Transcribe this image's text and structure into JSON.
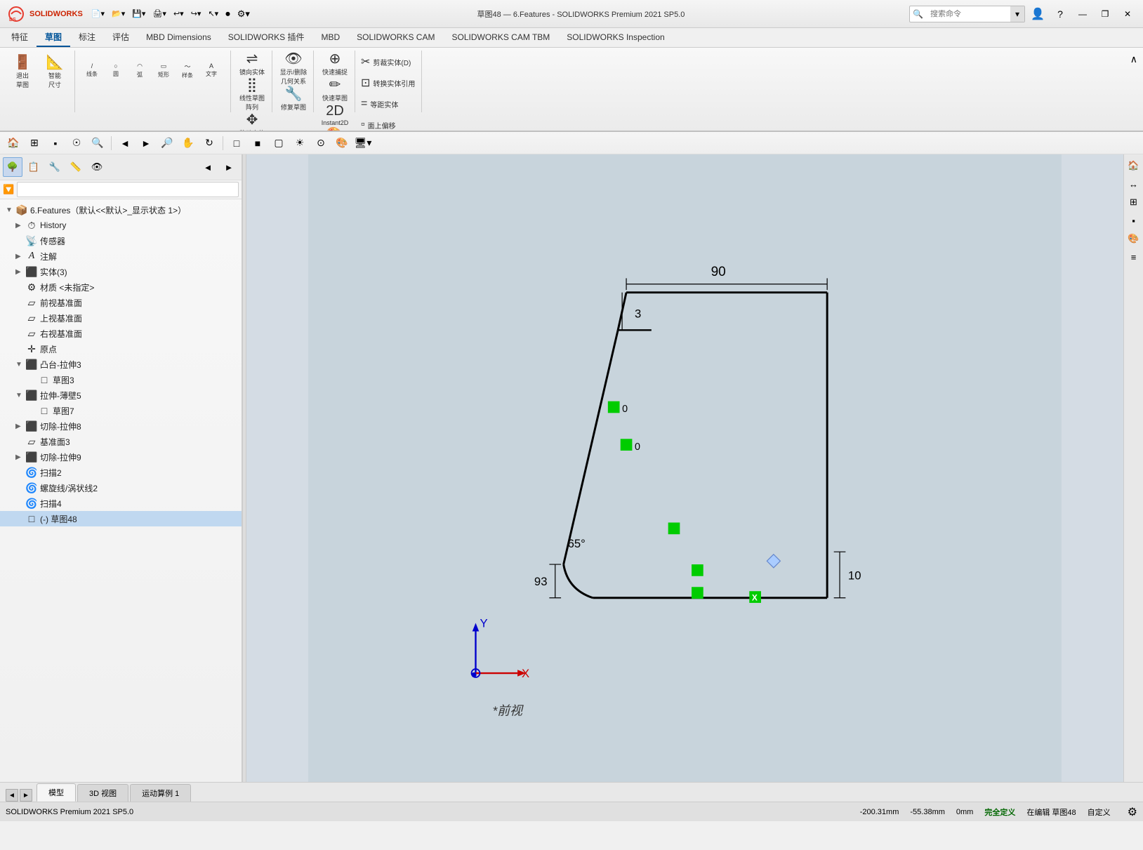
{
  "titlebar": {
    "title": "草图48 — 6.Features - SOLIDWORKS Premium 2021 SP5.0",
    "minimize": "—",
    "restore": "❐",
    "close": "✕"
  },
  "topbar": {
    "search_placeholder": "搜索命令",
    "search_btn": "🔍"
  },
  "ribbon": {
    "tabs": [
      "特征",
      "草图",
      "标注",
      "评估",
      "MBD Dimensions",
      "SOLIDWORKS 插件",
      "MBD",
      "SOLIDWORKS CAM",
      "SOLIDWORKS CAM TBM",
      "SOLIDWORKS Inspection"
    ],
    "active_tab": "草图",
    "collapse_icon": "∧"
  },
  "ribbon_tools_sketch": {
    "exit_sketch": "退出\n草图",
    "smart_dim": "智能\n尺寸",
    "mirror": "镜向实体",
    "linear_array": "线性草图阵列",
    "move": "移动实体",
    "show_hide": "显示/删除\n几何关系",
    "repair_sketch": "修复\n草图",
    "quick_capture": "快速\n捕捉",
    "quick_sketch": "快速\n草图",
    "instant2d": "Instant2D",
    "color_outline": "上色\n草图\n轮廓",
    "trim": "剪裁实\n体(D)",
    "convert": "转换实\n体引用",
    "equal": "等距\n实体",
    "face": "面\n上偏\n移"
  },
  "left_panel": {
    "title": "6.Features（默认<<默认>_显示状态 1>）",
    "filter_placeholder": "",
    "tree": [
      {
        "id": 0,
        "level": 0,
        "expanded": true,
        "icon": "📁",
        "label": "6.Features（默认<<默认>_显示状态 1>）",
        "hasExpand": false
      },
      {
        "id": 1,
        "level": 1,
        "expanded": false,
        "icon": "⏱",
        "label": "History",
        "hasExpand": true
      },
      {
        "id": 2,
        "level": 1,
        "expanded": false,
        "icon": "📡",
        "label": "传感器",
        "hasExpand": false
      },
      {
        "id": 3,
        "level": 1,
        "expanded": false,
        "icon": "A",
        "label": "注解",
        "hasExpand": true
      },
      {
        "id": 4,
        "level": 1,
        "expanded": false,
        "icon": "⬛",
        "label": "实体(3)",
        "hasExpand": true
      },
      {
        "id": 5,
        "level": 1,
        "expanded": false,
        "icon": "⚙",
        "label": "材质 <未指定>",
        "hasExpand": false
      },
      {
        "id": 6,
        "level": 1,
        "expanded": false,
        "icon": "▱",
        "label": "前视基准面",
        "hasExpand": false
      },
      {
        "id": 7,
        "level": 1,
        "expanded": false,
        "icon": "▱",
        "label": "上视基准面",
        "hasExpand": false
      },
      {
        "id": 8,
        "level": 1,
        "expanded": false,
        "icon": "▱",
        "label": "右视基准面",
        "hasExpand": false
      },
      {
        "id": 9,
        "level": 1,
        "expanded": false,
        "icon": "✛",
        "label": "原点",
        "hasExpand": false
      },
      {
        "id": 10,
        "level": 1,
        "expanded": true,
        "icon": "🟦",
        "label": "凸台-拉伸3",
        "hasExpand": true
      },
      {
        "id": 11,
        "level": 2,
        "expanded": false,
        "icon": "▱",
        "label": "草图3",
        "hasExpand": false
      },
      {
        "id": 12,
        "level": 1,
        "expanded": true,
        "icon": "🟦",
        "label": "拉伸-薄壁5",
        "hasExpand": true
      },
      {
        "id": 13,
        "level": 2,
        "expanded": false,
        "icon": "▱",
        "label": "草图7",
        "hasExpand": false
      },
      {
        "id": 14,
        "level": 1,
        "expanded": false,
        "icon": "🟦",
        "label": "切除-拉伸8",
        "hasExpand": true
      },
      {
        "id": 15,
        "level": 1,
        "expanded": false,
        "icon": "▱",
        "label": "基准面3",
        "hasExpand": false
      },
      {
        "id": 16,
        "level": 1,
        "expanded": false,
        "icon": "🟦",
        "label": "切除-拉伸9",
        "hasExpand": true
      },
      {
        "id": 17,
        "level": 1,
        "expanded": false,
        "icon": "🌀",
        "label": "扫描2",
        "hasExpand": false
      },
      {
        "id": 18,
        "level": 1,
        "expanded": false,
        "icon": "🌀",
        "label": "螺旋线/涡状线2",
        "hasExpand": false
      },
      {
        "id": 19,
        "level": 1,
        "expanded": false,
        "icon": "🌀",
        "label": "扫描4",
        "hasExpand": false
      },
      {
        "id": 20,
        "level": 1,
        "expanded": false,
        "icon": "▱",
        "label": "(-) 草图48",
        "hasExpand": false
      }
    ]
  },
  "viewport": {
    "view_label": "*前视",
    "dims": {
      "d90": "90",
      "d3": "3",
      "d93": "93",
      "d10": "10",
      "d65": "65°"
    }
  },
  "bottom_tabs": {
    "tabs": [
      "模型",
      "3D 视图",
      "运动算例 1"
    ],
    "active": "模型"
  },
  "status_bar": {
    "version": "SOLIDWORKS Premium 2021 SP5.0",
    "x_coord": "-200.31mm",
    "y_coord": "-55.38mm",
    "z_coord": "0mm",
    "status": "完全定义",
    "editing": "在编辑 草图48",
    "right_text": "自定义"
  }
}
